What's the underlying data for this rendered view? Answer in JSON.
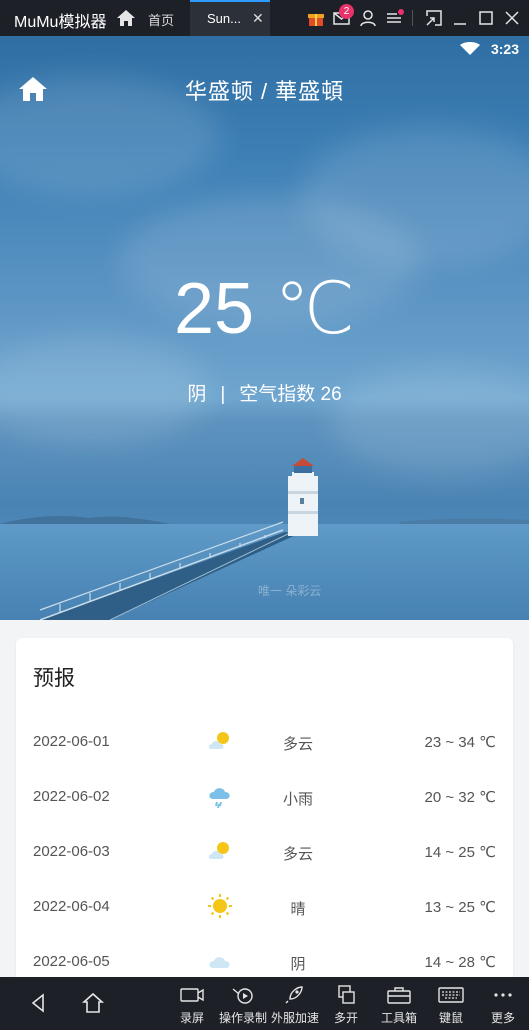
{
  "titlebar": {
    "brand": "MuMu模拟器",
    "home_tab_label": "首页",
    "active_tab_label": "Sun...",
    "mail_badge": "2",
    "icons": [
      "home-icon",
      "close-icon",
      "gift-icon",
      "mail-icon",
      "user-icon",
      "menu-icon",
      "screenshot-icon",
      "minimize-icon",
      "maximize-icon",
      "close-window-icon"
    ]
  },
  "status_bar": {
    "time": "3:23",
    "icons": [
      "wifi-icon"
    ]
  },
  "weather": {
    "city": "华盛顿 / 華盛頓",
    "temperature": "25 ℃",
    "condition": "阴",
    "divider": "|",
    "aqi": "空气指数 26",
    "watermark": "唯一 朵彩云"
  },
  "forecast": {
    "title": "预报",
    "rows": [
      {
        "date": "2022-06-01",
        "icon": "partly-cloudy-icon",
        "desc": "多云",
        "range": "23 ~ 34 ℃"
      },
      {
        "date": "2022-06-02",
        "icon": "rain-icon",
        "desc": "小雨",
        "range": "20 ~ 32 ℃"
      },
      {
        "date": "2022-06-03",
        "icon": "partly-cloudy-icon",
        "desc": "多云",
        "range": "14 ~ 25 ℃"
      },
      {
        "date": "2022-06-04",
        "icon": "sun-icon",
        "desc": "晴",
        "range": "13 ~ 25 ℃"
      },
      {
        "date": "2022-06-05",
        "icon": "cloud-icon",
        "desc": "阴",
        "range": "14 ~ 28 ℃"
      }
    ]
  },
  "toolbar": {
    "items": [
      {
        "label": "录屏",
        "icon": "record-screen-icon"
      },
      {
        "label": "操作录制",
        "icon": "macro-record-icon"
      },
      {
        "label": "外服加速",
        "icon": "rocket-icon"
      },
      {
        "label": "多开",
        "icon": "multi-instance-icon"
      },
      {
        "label": "工具箱",
        "icon": "toolbox-icon"
      },
      {
        "label": "键鼠",
        "icon": "keyboard-icon"
      },
      {
        "label": "更多",
        "icon": "more-icon"
      }
    ]
  },
  "colors": {
    "accent": "#2e9bff",
    "badge": "#e8336b",
    "sun": "#f5c518",
    "rain_cloud": "#7cc0ea",
    "sky_top": "#2f6ea3"
  }
}
